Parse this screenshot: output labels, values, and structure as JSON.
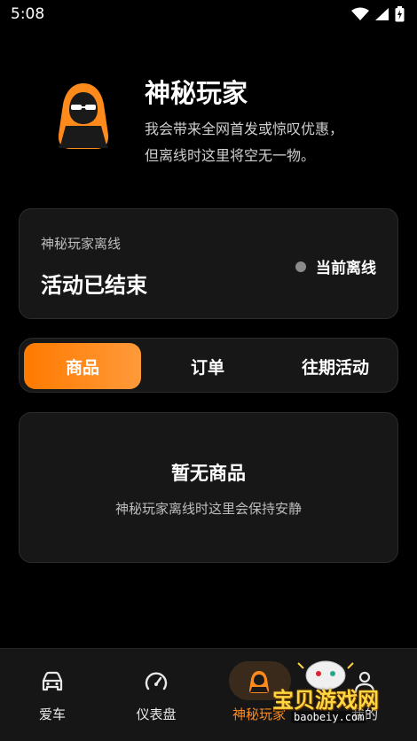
{
  "status_bar": {
    "time": "5:08",
    "icons": [
      "wifi-icon",
      "signal-icon",
      "battery-charging-icon"
    ]
  },
  "hero": {
    "title": "神秘玩家",
    "description_line1": "我会带来全网首发或惊叹优惠，",
    "description_line2": "但离线时这里将空无一物。",
    "avatar_icon": "hooded-hacker-icon"
  },
  "status_card": {
    "label": "神秘玩家离线",
    "title": "活动已结束",
    "indicator_label": "当前离线"
  },
  "tabs": [
    {
      "label": "商品",
      "active": true
    },
    {
      "label": "订单",
      "active": false
    },
    {
      "label": "往期活动",
      "active": false
    }
  ],
  "empty_state": {
    "title": "暂无商品",
    "description": "神秘玩家离线时这里会保持安静"
  },
  "bottom_nav": [
    {
      "label": "爱车",
      "icon": "car-icon",
      "active": false
    },
    {
      "label": "仪表盘",
      "icon": "speedometer-icon",
      "active": false
    },
    {
      "label": "神秘玩家",
      "icon": "hooded-hacker-icon",
      "active": true
    },
    {
      "label": "我的",
      "icon": "person-icon",
      "active": false
    }
  ],
  "watermark": {
    "text": "宝贝游戏网",
    "url": "baobeiy.com"
  },
  "colors": {
    "accent": "#ff8a1c",
    "card_bg": "#171717",
    "background": "#000000",
    "offline_dot": "#8a8a8a"
  }
}
